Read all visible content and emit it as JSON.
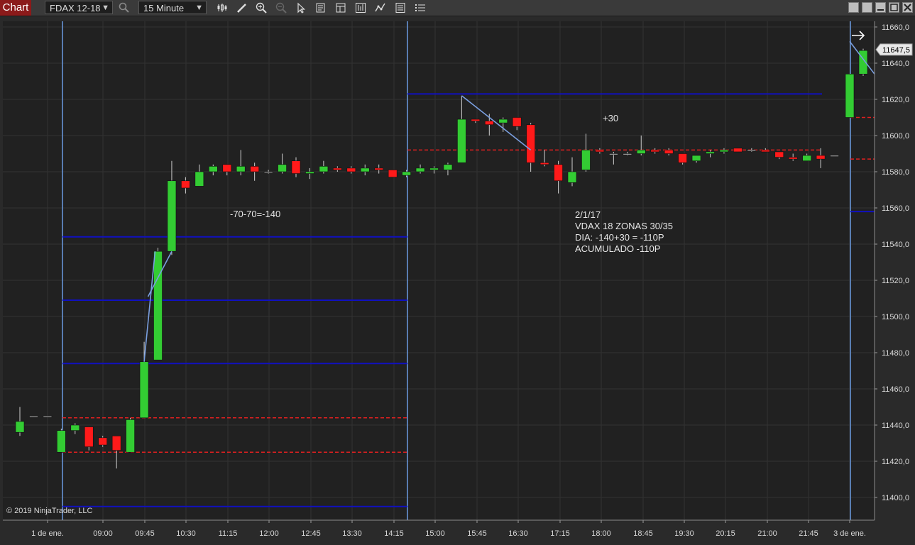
{
  "app": {
    "tab_label": "Chart"
  },
  "toolbar": {
    "instrument": "FDAX 12-18",
    "interval": "15 Minute",
    "icons": [
      "search-icon",
      "bars-type-icon",
      "pencil-icon",
      "zoom-in-icon",
      "zoom-out-icon",
      "pointer-icon",
      "data-box-icon",
      "strategies-icon",
      "chart-trader-icon",
      "indicators-icon",
      "properties-icon",
      "list-icon"
    ]
  },
  "window_buttons": [
    "tile-icon",
    "restore-icon",
    "minimize-icon",
    "maximize-icon",
    "close-icon"
  ],
  "colors": {
    "up": "#33cc33",
    "down": "#ff1a1a",
    "wick": "#cfcfcf",
    "zone_line": "#1010c0",
    "dashed_line": "#e02020",
    "session_line": "#6a9ae0",
    "trend_line": "#7a9fe0"
  },
  "chart_data": {
    "type": "candlestick",
    "instrument": "FDAX 12-18",
    "interval": "15 Minute",
    "ylim": [
      11390,
      11665
    ],
    "y_ticks": [
      "11660,0",
      "11640,0",
      "11620,0",
      "11600,0",
      "11580,0",
      "11560,0",
      "11540,0",
      "11520,0",
      "11500,0",
      "11480,0",
      "11460,0",
      "11440,0",
      "11420,0",
      "11400,0"
    ],
    "x_ticks": [
      "1 de ene.",
      "09:00",
      "09:45",
      "10:30",
      "11:15",
      "12:00",
      "12:45",
      "13:30",
      "14:15",
      "15:00",
      "15:45",
      "16:30",
      "17:15",
      "18:00",
      "18:45",
      "19:30",
      "20:15",
      "21:00",
      "21:45",
      "3 de ene."
    ],
    "last_price": "11647,5",
    "candles": [
      {
        "t": "08:00",
        "o": 11436,
        "h": 11450,
        "l": 11434,
        "c": 11442
      },
      {
        "t": "08:15",
        "o": 11445,
        "h": 11445,
        "l": 11445,
        "c": 11445
      },
      {
        "t": "08:30",
        "o": 11445,
        "h": 11445,
        "l": 11445,
        "c": 11445
      },
      {
        "t": "08:45",
        "o": 11425,
        "h": 11438,
        "l": 11425,
        "c": 11437
      },
      {
        "t": "09:00",
        "o": 11437,
        "h": 11441,
        "l": 11435,
        "c": 11440
      },
      {
        "t": "09:15",
        "o": 11439,
        "h": 11439,
        "l": 11426,
        "c": 11428
      },
      {
        "t": "09:30",
        "o": 11433,
        "h": 11434,
        "l": 11428,
        "c": 11429
      },
      {
        "t": "09:45",
        "o": 11434,
        "h": 11434,
        "l": 11416,
        "c": 11426
      },
      {
        "t": "10:00",
        "o": 11425,
        "h": 11444,
        "l": 11425,
        "c": 11443
      },
      {
        "t": "10:15",
        "o": 11444,
        "h": 11486,
        "l": 11444,
        "c": 11475
      },
      {
        "t": "10:30",
        "o": 11476,
        "h": 11538,
        "l": 11476,
        "c": 11536
      },
      {
        "t": "10:45",
        "o": 11536,
        "h": 11586,
        "l": 11534,
        "c": 11575
      },
      {
        "t": "11:00",
        "o": 11575,
        "h": 11577,
        "l": 11568,
        "c": 11571
      },
      {
        "t": "11:15",
        "o": 11572,
        "h": 11584,
        "l": 11572,
        "c": 11580
      },
      {
        "t": "11:30",
        "o": 11580,
        "h": 11584,
        "l": 11578,
        "c": 11583
      },
      {
        "t": "11:45",
        "o": 11584,
        "h": 11584,
        "l": 11578,
        "c": 11580
      },
      {
        "t": "12:00",
        "o": 11580,
        "h": 11592,
        "l": 11578,
        "c": 11583
      },
      {
        "t": "12:15",
        "o": 11583,
        "h": 11585,
        "l": 11575,
        "c": 11580
      },
      {
        "t": "12:30",
        "o": 11580,
        "h": 11581,
        "l": 11579,
        "c": 11580
      },
      {
        "t": "12:45",
        "o": 11580,
        "h": 11590,
        "l": 11579,
        "c": 11584
      },
      {
        "t": "13:00",
        "o": 11586,
        "h": 11588,
        "l": 11577,
        "c": 11579
      },
      {
        "t": "13:15",
        "o": 11579,
        "h": 11582,
        "l": 11576,
        "c": 11580
      },
      {
        "t": "13:30",
        "o": 11580,
        "h": 11586,
        "l": 11579,
        "c": 11583
      },
      {
        "t": "13:45",
        "o": 11582,
        "h": 11583,
        "l": 11580,
        "c": 11581
      },
      {
        "t": "14:00",
        "o": 11582,
        "h": 11583,
        "l": 11579,
        "c": 11580
      },
      {
        "t": "14:15",
        "o": 11580,
        "h": 11584,
        "l": 11578,
        "c": 11582
      },
      {
        "t": "14:30",
        "o": 11582,
        "h": 11584,
        "l": 11579,
        "c": 11581
      },
      {
        "t": "14:45",
        "o": 11581,
        "h": 11581,
        "l": 11577,
        "c": 11577
      },
      {
        "t": "15:00",
        "o": 11578,
        "h": 11581,
        "l": 11577,
        "c": 11580
      },
      {
        "t": "15:15",
        "o": 11580,
        "h": 11584,
        "l": 11579,
        "c": 11582
      },
      {
        "t": "15:30",
        "o": 11581,
        "h": 11583,
        "l": 11579,
        "c": 11582
      },
      {
        "t": "15:45",
        "o": 11581,
        "h": 11585,
        "l": 11578,
        "c": 11584
      },
      {
        "t": "16:00",
        "o": 11585,
        "h": 11622,
        "l": 11585,
        "c": 11609
      },
      {
        "t": "16:15",
        "o": 11609,
        "h": 11609,
        "l": 11607,
        "c": 11608
      },
      {
        "t": "16:30",
        "o": 11608,
        "h": 11612,
        "l": 11600,
        "c": 11606
      },
      {
        "t": "16:45",
        "o": 11607,
        "h": 11610,
        "l": 11602,
        "c": 11609
      },
      {
        "t": "17:00",
        "o": 11610,
        "h": 11610,
        "l": 11603,
        "c": 11605
      },
      {
        "t": "17:15",
        "o": 11606,
        "h": 11607,
        "l": 11580,
        "c": 11585
      },
      {
        "t": "17:30",
        "o": 11585,
        "h": 11592,
        "l": 11583,
        "c": 11584
      },
      {
        "t": "17:45",
        "o": 11584,
        "h": 11586,
        "l": 11568,
        "c": 11575
      },
      {
        "t": "18:00",
        "o": 11574,
        "h": 11588,
        "l": 11572,
        "c": 11580
      },
      {
        "t": "18:15",
        "o": 11581,
        "h": 11601,
        "l": 11580,
        "c": 11592
      },
      {
        "t": "18:30",
        "o": 11592,
        "h": 11593,
        "l": 11590,
        "c": 11591
      },
      {
        "t": "18:45",
        "o": 11590,
        "h": 11591,
        "l": 11584,
        "c": 11590
      },
      {
        "t": "19:00",
        "o": 11590,
        "h": 11591,
        "l": 11589,
        "c": 11590
      },
      {
        "t": "19:15",
        "o": 11590,
        "h": 11600,
        "l": 11589,
        "c": 11592
      },
      {
        "t": "19:30",
        "o": 11592,
        "h": 11593,
        "l": 11590,
        "c": 11591
      },
      {
        "t": "19:45",
        "o": 11592,
        "h": 11593,
        "l": 11589,
        "c": 11590
      },
      {
        "t": "20:00",
        "o": 11590,
        "h": 11590,
        "l": 11584,
        "c": 11585
      },
      {
        "t": "20:15",
        "o": 11586,
        "h": 11589,
        "l": 11585,
        "c": 11589
      },
      {
        "t": "20:30",
        "o": 11590,
        "h": 11592,
        "l": 11588,
        "c": 11591
      },
      {
        "t": "20:45",
        "o": 11591,
        "h": 11593,
        "l": 11590,
        "c": 11592
      },
      {
        "t": "21:00",
        "o": 11593,
        "h": 11593,
        "l": 11591,
        "c": 11591
      },
      {
        "t": "21:15",
        "o": 11592,
        "h": 11593,
        "l": 11591,
        "c": 11592
      },
      {
        "t": "21:30",
        "o": 11592,
        "h": 11593,
        "l": 11591,
        "c": 11591
      },
      {
        "t": "21:45",
        "o": 11591,
        "h": 11591,
        "l": 11587,
        "c": 11588
      },
      {
        "t": "22:00",
        "o": 11588,
        "h": 11590,
        "l": 11586,
        "c": 11587
      },
      {
        "t": "22:15",
        "o": 11586,
        "h": 11590,
        "l": 11586,
        "c": 11589
      },
      {
        "t": "22:30",
        "o": 11589,
        "h": 11593,
        "l": 11582,
        "c": 11587
      },
      {
        "t": "22:45",
        "o": 11589,
        "h": 11589,
        "l": 11589,
        "c": 11589
      },
      {
        "t": "03-08:00",
        "o": 11610,
        "h": 11634,
        "l": 11610,
        "c": 11634
      },
      {
        "t": "03-08:15",
        "o": 11634,
        "h": 11648,
        "l": 11633,
        "c": 11647
      }
    ],
    "zone_lines": [
      11623,
      11544,
      11509,
      11474,
      11395,
      11558
    ],
    "dashed_lines": [
      11444,
      11425,
      11592,
      11610,
      11587
    ],
    "annotations": [
      {
        "text": "-70-70=-140"
      },
      {
        "text": "+30"
      },
      {
        "lines": [
          "2/1/17",
          "VDAX 18 ZONAS 30/35",
          "DIA: -140+30 = -110P",
          "ACUMULADO -110P"
        ]
      }
    ]
  },
  "copyright": "© 2019 NinjaTrader, LLC"
}
